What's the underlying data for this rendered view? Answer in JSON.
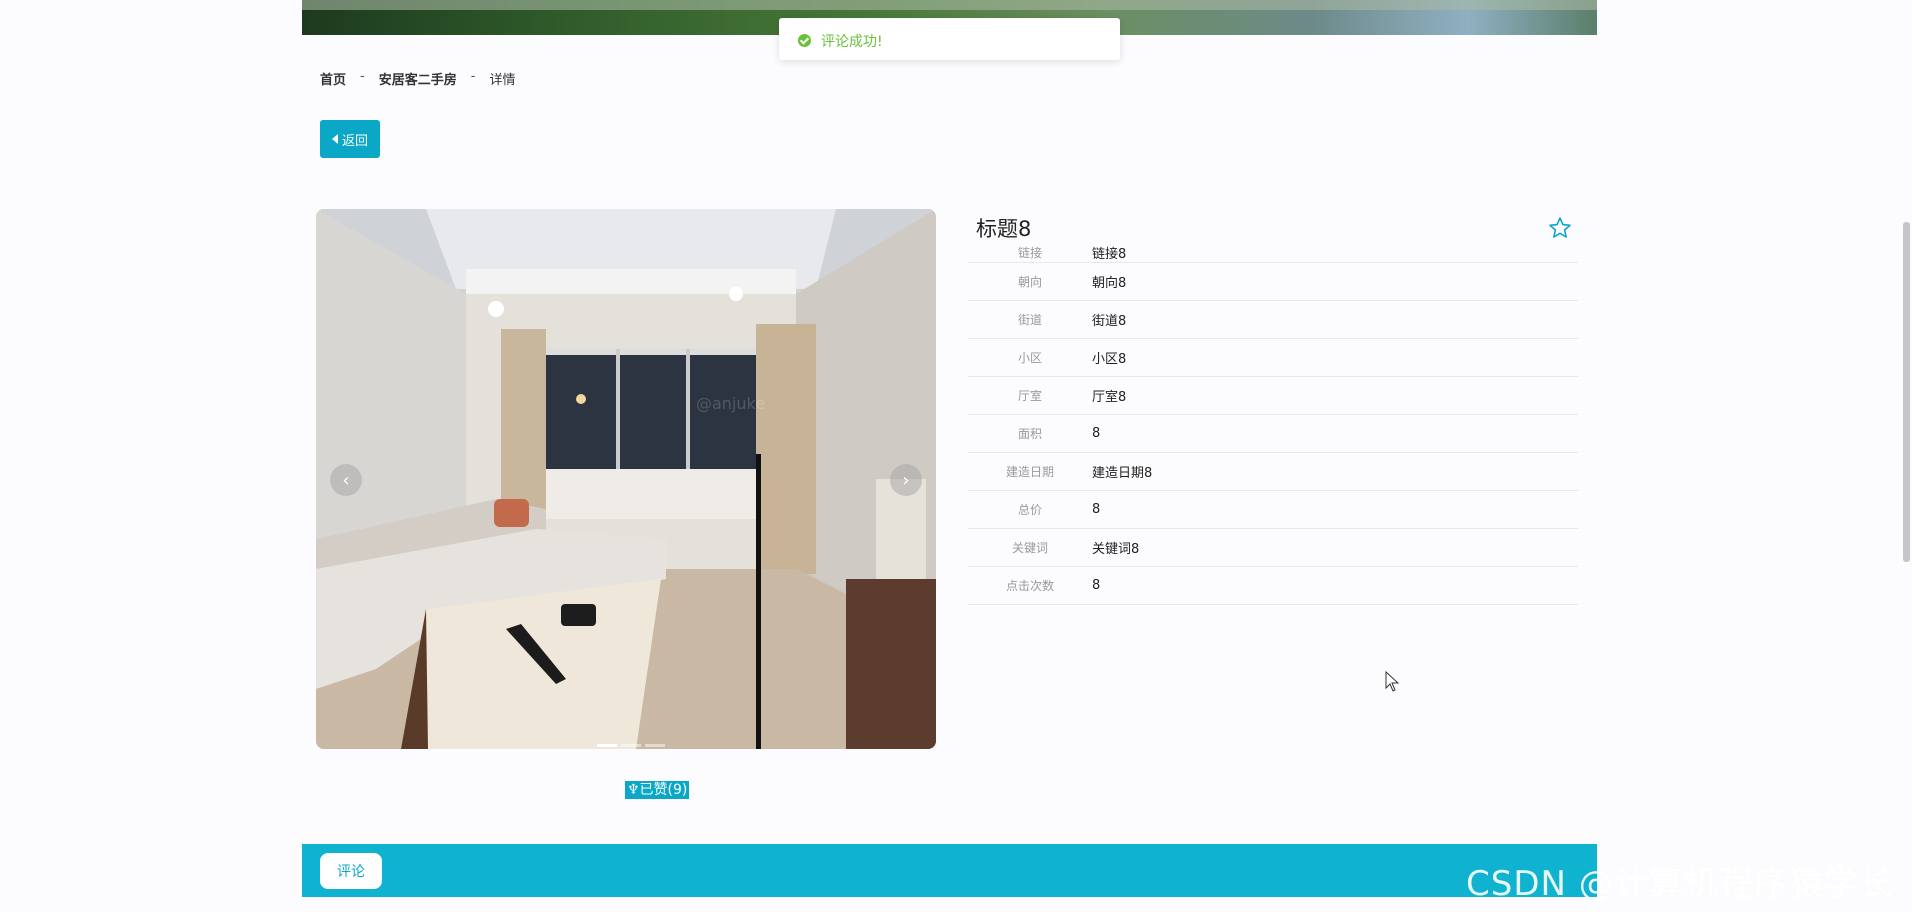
{
  "toast": {
    "icon": "check-circle-icon",
    "message": "评论成功!"
  },
  "breadcrumb": {
    "home": "首页",
    "separator": "-",
    "section": "安居客二手房",
    "current": "详情"
  },
  "back_button": {
    "label": "返回",
    "icon": "caret-left-icon"
  },
  "carousel": {
    "prev_icon": "‹",
    "next_icon": "›",
    "slide_count": 3,
    "active_index": 0
  },
  "like_button": {
    "label": "♆已赞(9)"
  },
  "detail": {
    "title": "标题8",
    "favorite_icon": "star-outline-icon",
    "fields": [
      {
        "label": "链接",
        "value": "链接8"
      },
      {
        "label": "朝向",
        "value": "朝向8"
      },
      {
        "label": "街道",
        "value": "街道8"
      },
      {
        "label": "小区",
        "value": "小区8"
      },
      {
        "label": "厅室",
        "value": "厅室8"
      },
      {
        "label": "面积",
        "value": "8"
      },
      {
        "label": "建造日期",
        "value": "建造日期8"
      },
      {
        "label": "总价",
        "value": "8"
      },
      {
        "label": "关键词",
        "value": "关键词8"
      },
      {
        "label": "点击次数",
        "value": "8"
      }
    ]
  },
  "comment_tab": {
    "label": "评论"
  },
  "watermark": "CSDN @计算机程序猿学长",
  "colors": {
    "accent": "#0aa7c7",
    "success": "#67c23a",
    "footer": "#0fb3d0"
  }
}
